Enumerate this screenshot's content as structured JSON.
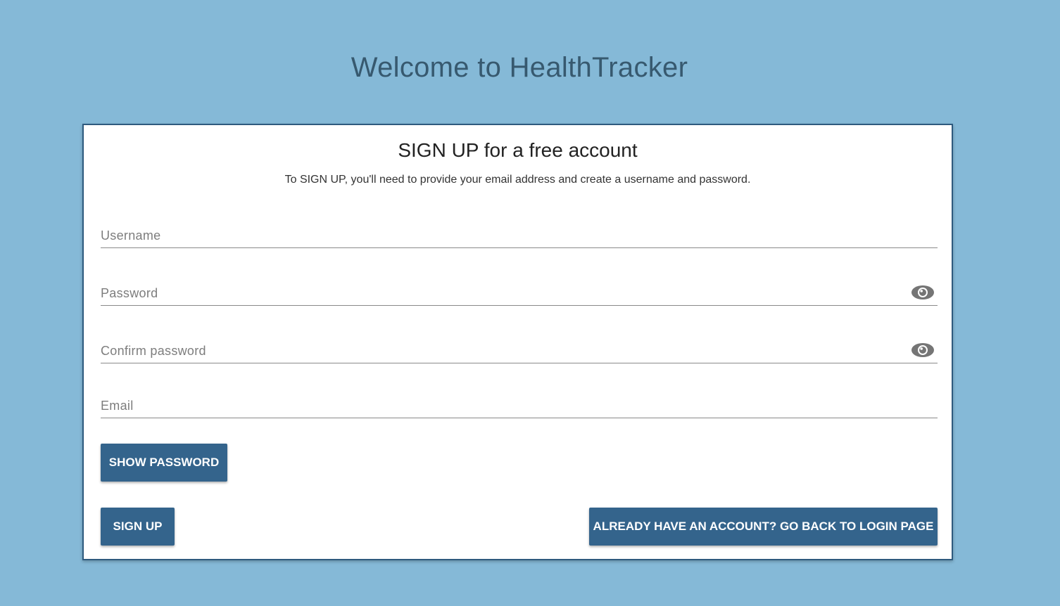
{
  "page": {
    "title": "Welcome to HealthTracker"
  },
  "card": {
    "title": "SIGN UP for a free account",
    "subtitle": "To SIGN UP, you'll need to provide your email address and create a username and password."
  },
  "form": {
    "username_placeholder": "Username",
    "password_placeholder": "Password",
    "confirm_password_placeholder": "Confirm password",
    "email_placeholder": "Email",
    "username_value": "",
    "password_value": "",
    "confirm_password_value": "",
    "email_value": ""
  },
  "buttons": {
    "show_password": "SHOW PASSWORD",
    "sign_up": "SIGN UP",
    "go_to_login": "ALREADY HAVE AN ACCOUNT? GO BACK TO LOGIN PAGE"
  },
  "icons": {
    "password_toggle": "eye-icon",
    "confirm_password_toggle": "eye-icon"
  },
  "colors": {
    "background": "#85b9d7",
    "primary": "#34648c",
    "title": "#37596f",
    "card_border": "#2e5a7e"
  }
}
